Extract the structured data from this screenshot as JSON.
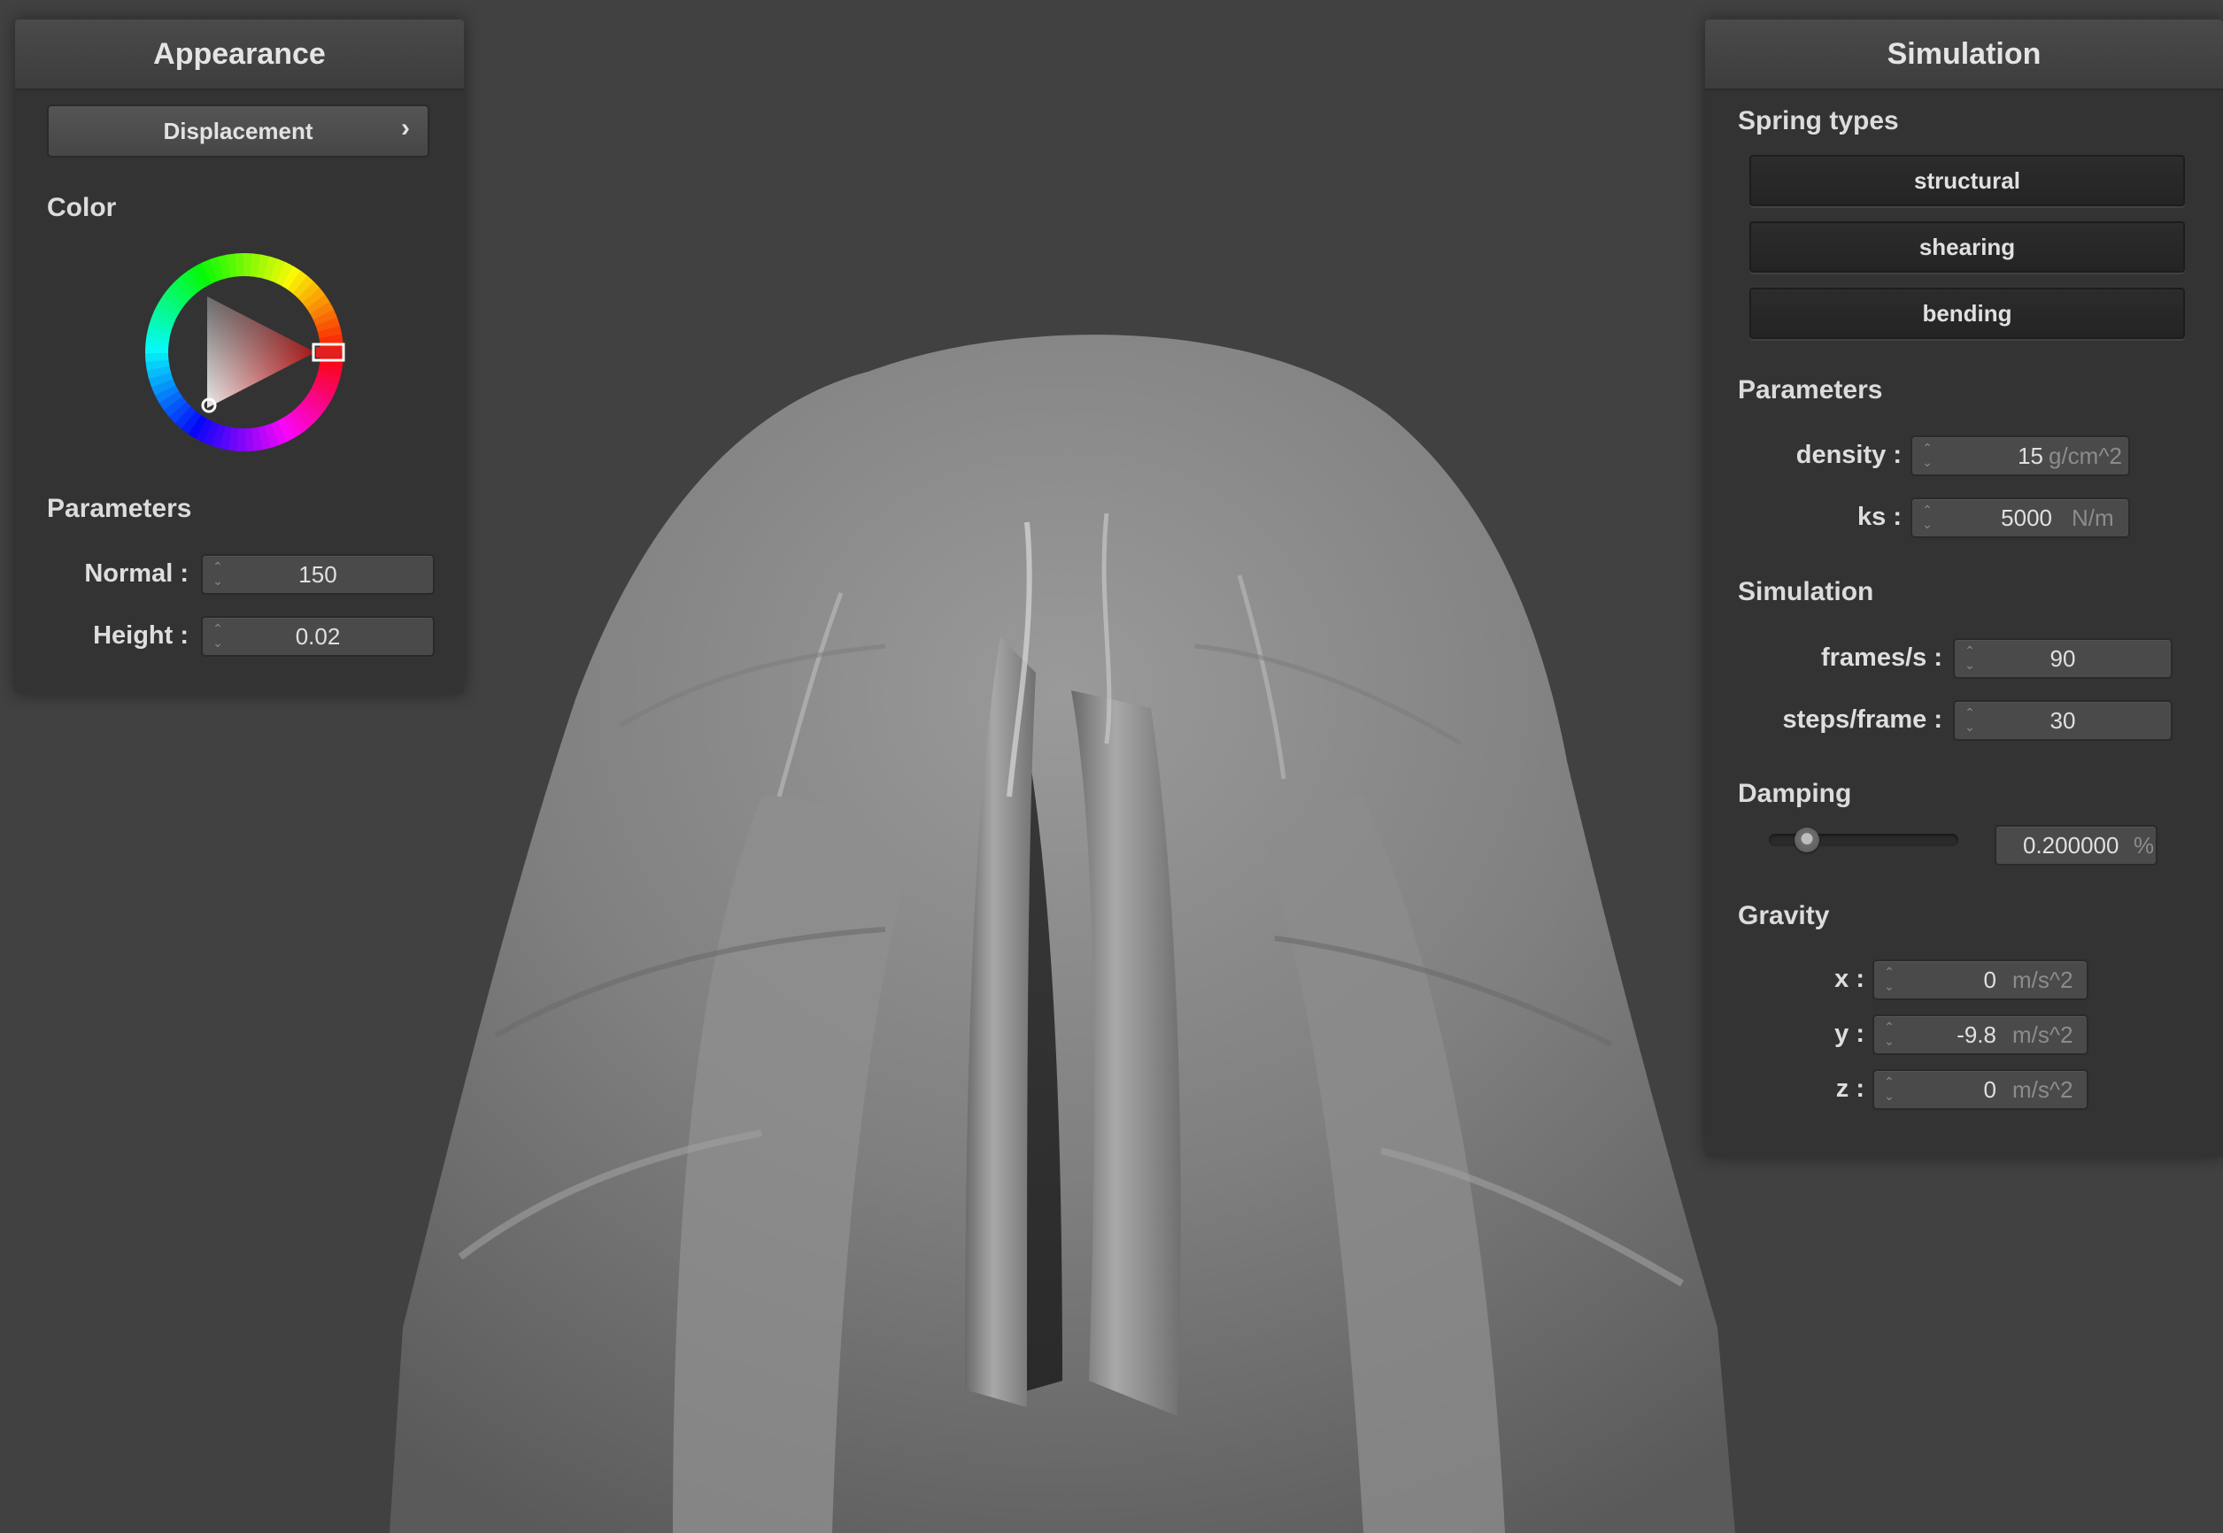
{
  "appearance": {
    "title": "Appearance",
    "mode_button": "Displacement",
    "mode_chevron": "›",
    "color_label": "Color",
    "selected_color": "#e22020",
    "parameters_label": "Parameters",
    "normal_label": "Normal :",
    "normal_value": "150",
    "height_label": "Height :",
    "height_value": "0.02"
  },
  "simulation": {
    "title": "Simulation",
    "spring_types_label": "Spring types",
    "spring_types": [
      "structural",
      "shearing",
      "bending"
    ],
    "parameters_label": "Parameters",
    "density_label": "density :",
    "density_value": "15",
    "density_unit": "g/cm^2",
    "ks_label": "ks :",
    "ks_value": "5000",
    "ks_unit": "N/m",
    "simulation_label": "Simulation",
    "fps_label": "frames/s :",
    "fps_value": "90",
    "steps_label": "steps/frame :",
    "steps_value": "30",
    "damping_label": "Damping",
    "damping_fraction": 0.2,
    "damping_value": "0.200000",
    "damping_unit": "%",
    "gravity_label": "Gravity",
    "gx_label": "x :",
    "gx_value": "0",
    "gy_label": "y :",
    "gy_value": "-9.8",
    "gz_label": "z :",
    "gz_value": "0",
    "gravity_unit": "m/s^2"
  },
  "colors": {
    "background": "#414141",
    "panel": "#333333",
    "cloth": "#8a8a8a"
  }
}
